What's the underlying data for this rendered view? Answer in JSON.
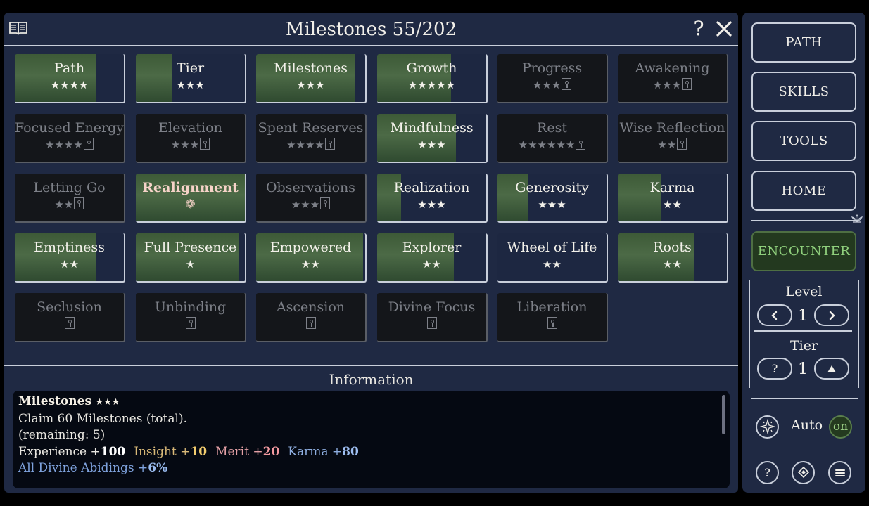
{
  "header": {
    "title": "Milestones 55/202",
    "help_label": "?"
  },
  "tiles": [
    {
      "name": "Path",
      "stars": "★★★★",
      "locked": false,
      "fill": 0.75
    },
    {
      "name": "Tier",
      "stars": "★★★",
      "locked": false,
      "fill": 0.33
    },
    {
      "name": "Milestones",
      "stars": "★★★",
      "locked": false,
      "fill": 0.9
    },
    {
      "name": "Growth",
      "stars": "★★★★★",
      "locked": false,
      "fill": 0.68
    },
    {
      "name": "Progress",
      "stars": "★★★",
      "locked": true
    },
    {
      "name": "Awakening",
      "stars": "★★★",
      "locked": true
    },
    {
      "name": "Focused Energy",
      "stars": "★★★★",
      "locked": true
    },
    {
      "name": "Elevation",
      "stars": "★★★",
      "locked": true
    },
    {
      "name": "Spent Reserves",
      "stars": "★★★★",
      "locked": true
    },
    {
      "name": "Mindfulness",
      "stars": "★★★",
      "locked": false,
      "fill": 0.72
    },
    {
      "name": "Rest",
      "stars": "★★★★★★",
      "locked": true
    },
    {
      "name": "Wise Reflection",
      "stars": "★★",
      "locked": true
    },
    {
      "name": "Letting Go",
      "stars": "★★",
      "locked": true
    },
    {
      "name": "Realignment",
      "stars": "❁",
      "locked": false,
      "fill": 1.0,
      "highlight": true
    },
    {
      "name": "Observations",
      "stars": "★★★",
      "locked": true
    },
    {
      "name": "Realization",
      "stars": "★★★",
      "locked": false,
      "fill": 0.22
    },
    {
      "name": "Generosity",
      "stars": "★★★",
      "locked": false,
      "fill": 0.28
    },
    {
      "name": "Karma",
      "stars": "★★",
      "locked": false,
      "fill": 0.4
    },
    {
      "name": "Emptiness",
      "stars": "★★",
      "locked": false,
      "fill": 0.74
    },
    {
      "name": "Full Presence",
      "stars": "★",
      "locked": false,
      "fill": 0.95
    },
    {
      "name": "Empowered",
      "stars": "★★",
      "locked": false,
      "fill": 0.98
    },
    {
      "name": "Explorer",
      "stars": "★★",
      "locked": false,
      "fill": 0.7
    },
    {
      "name": "Wheel of Life",
      "stars": "★★",
      "locked": false,
      "fill": 0.0
    },
    {
      "name": "Roots",
      "stars": "★★",
      "locked": false,
      "fill": 0.7
    },
    {
      "name": "Seclusion",
      "stars": "",
      "locked": true
    },
    {
      "name": "Unbinding",
      "stars": "",
      "locked": true
    },
    {
      "name": "Ascension",
      "stars": "",
      "locked": true
    },
    {
      "name": "Divine Focus",
      "stars": "",
      "locked": true
    },
    {
      "name": "Liberation",
      "stars": "",
      "locked": true
    }
  ],
  "info": {
    "section_title": "Information",
    "heading": "Milestones",
    "heading_stars": "★★★",
    "line1": "Claim 60 Milestones (total).",
    "line2": "(remaining: 5)",
    "rewards": [
      {
        "label": "Experience",
        "value": "100",
        "kind": "exp"
      },
      {
        "label": "Insight",
        "value": "10",
        "kind": "ins"
      },
      {
        "label": "Merit",
        "value": "20",
        "kind": "mer"
      },
      {
        "label": "Karma",
        "value": "80",
        "kind": "kar"
      }
    ],
    "bonus_label": "All Divine Abidings",
    "bonus_value": "6%"
  },
  "sidebar": {
    "nav": [
      "PATH",
      "SKILLS",
      "TOOLS",
      "HOME"
    ],
    "encounter": "ENCOUNTER",
    "level_label": "Level",
    "level_value": "1",
    "tier_label": "Tier",
    "tier_value": "1",
    "tier_help": "?",
    "auto_label": "Auto",
    "auto_state": "on",
    "help_label": "?"
  },
  "colors": {
    "panel": "#1f2943",
    "tile_green": "#4c6a46",
    "encounter_text": "#8fcf7c",
    "highlight_text": "#f6d3c8"
  }
}
